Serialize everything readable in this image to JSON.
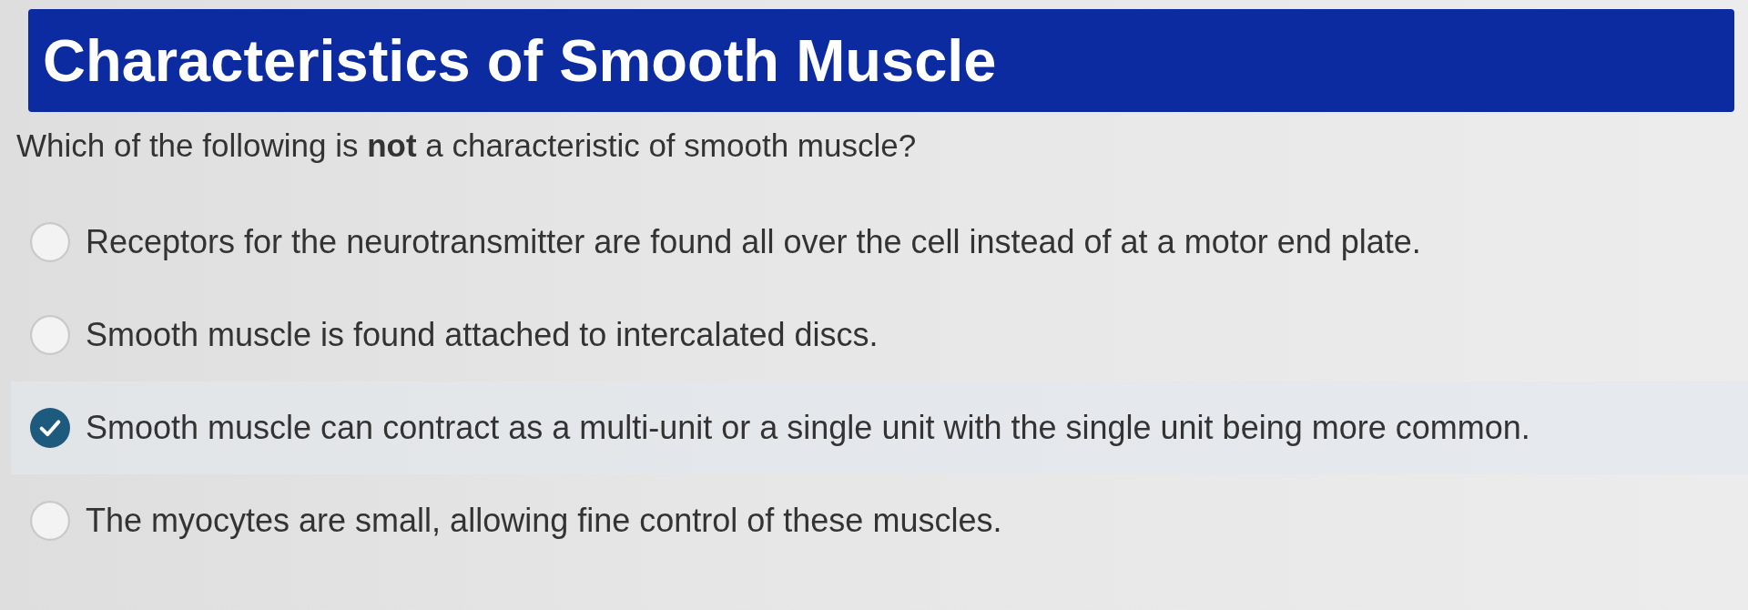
{
  "header": {
    "title": "Characteristics of Smooth Muscle"
  },
  "question": {
    "text": "Which of the following is **not** a characteristic of smooth muscle?"
  },
  "options": [
    {
      "label": "Receptors for the neurotransmitter are found all over the cell instead of at a motor end plate.",
      "selected": false
    },
    {
      "label": "Smooth muscle is found attached to intercalated discs.",
      "selected": false
    },
    {
      "label": "Smooth muscle can contract as a multi-unit or a single unit with the single unit being more common.",
      "selected": true
    },
    {
      "label": "The myocytes are small, allowing fine control of these muscles.",
      "selected": false
    }
  ]
}
